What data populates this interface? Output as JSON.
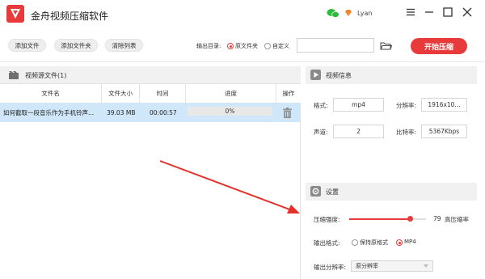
{
  "app": {
    "title": "金舟视频压缩软件"
  },
  "user": {
    "name": "Lyan"
  },
  "toolbar": {
    "add_file": "添加文件",
    "add_folder": "添加文件夹",
    "clear_list": "清除列表",
    "output_dir_label": "输出目录:",
    "output_options": [
      "原文件夹",
      "自定义"
    ],
    "output_selected": "原文件夹",
    "path_value": "",
    "start_label": "开始压缩"
  },
  "file_panel": {
    "title": "视频源文件(1)",
    "columns": [
      "文件名",
      "文件大小",
      "时间",
      "进度",
      "操作"
    ],
    "rows": [
      {
        "name": "如何截取一段音乐作为手机铃声...",
        "size": "39.03 MB",
        "duration": "00:00:57",
        "progress": "0%",
        "progress_value": 0
      }
    ]
  },
  "video_info": {
    "title": "视频信息",
    "format_label": "格式:",
    "format_value": "mp4",
    "resolution_label": "分辨率:",
    "resolution_value": "1916x10...",
    "channels_label": "声道:",
    "channels_value": "2",
    "bitrate_label": "比特率:",
    "bitrate_value": "5367Kbps"
  },
  "settings": {
    "title": "设置",
    "strength_label": "压缩强度:",
    "strength_value": "79",
    "strength_level": 0.79,
    "strength_hint": "高压缩率",
    "format_label": "输出格式:",
    "format_options": [
      "保持原格式",
      "MP4"
    ],
    "format_selected": "MP4",
    "resolution_label": "输出分辨率:",
    "resolution_selected": "原分辨率"
  },
  "colors": {
    "accent": "#e83a3a",
    "row_selected": "#cfe7f8",
    "panel_head": "#f1f1f1"
  },
  "icons": [
    "app-logo-icon",
    "wechat-icon",
    "vip-diamond-icon",
    "menu-icon",
    "minimize-icon",
    "maximize-icon",
    "close-icon",
    "folder-icon",
    "film-icon",
    "trash-icon",
    "play-icon",
    "gear-icon"
  ]
}
